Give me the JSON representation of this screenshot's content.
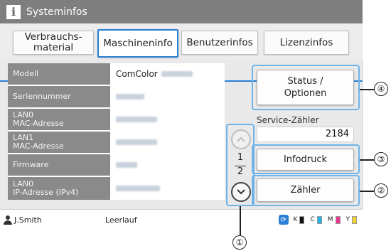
{
  "title": "Systeminfos",
  "tabs": [
    {
      "label": "Verbrauchs-\nmaterial"
    },
    {
      "label": "Maschineninfo"
    },
    {
      "label": "Benutzerinfos"
    },
    {
      "label": "Lizenzinfos"
    }
  ],
  "active_tab": "Maschineninfo",
  "info_rows": [
    {
      "label": "Modell",
      "value": "ComColor"
    },
    {
      "label": "Seriennummer",
      "value": ""
    },
    {
      "label": "LAN0\nMAC-Adresse",
      "value": ""
    },
    {
      "label": "LAN1\nMAC-Adresse",
      "value": ""
    },
    {
      "label": "Firmware",
      "value": ""
    },
    {
      "label": "LAN0\nIP-Adresse (IPv4)",
      "value": ""
    }
  ],
  "pager": {
    "current": "1",
    "total": "2",
    "up_icon": "chevron-up-icon",
    "down_icon": "chevron-down-icon"
  },
  "buttons": {
    "status_options": "Status /\nOptionen",
    "infodruck": "Infodruck",
    "zaehler": "Zähler"
  },
  "service_counter": {
    "label": "Service-Zähler",
    "value": "2184"
  },
  "status_bar": {
    "user": "J.Smith",
    "state": "Leerlauf",
    "inks": [
      {
        "label": "K",
        "color": "#111111"
      },
      {
        "label": "C",
        "color": "#1fb3e8"
      },
      {
        "label": "M",
        "color": "#e8368f"
      },
      {
        "label": "Y",
        "color": "#f2d22c"
      }
    ]
  },
  "callouts": [
    "①",
    "②",
    "③",
    "④"
  ],
  "colors": {
    "accent": "#2a7fd4",
    "highlight": "#6fb4e8",
    "titlebar": "#7f7f7f",
    "label_bg": "#8a8a8a"
  }
}
